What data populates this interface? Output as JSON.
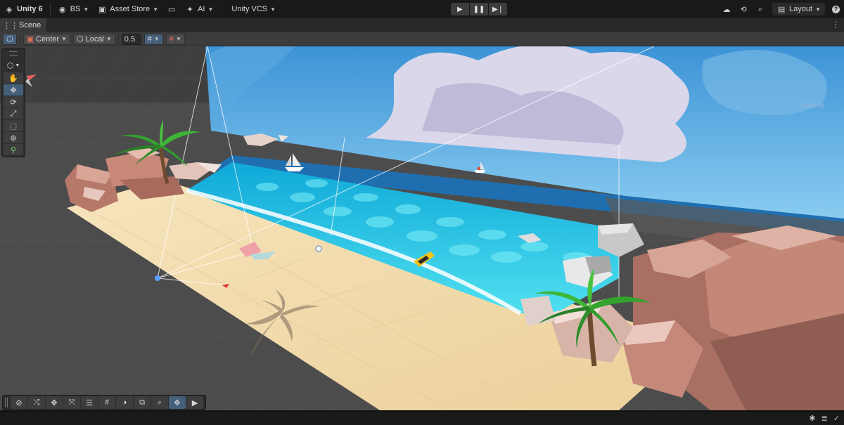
{
  "topbar": {
    "unity_label": "Unity 6",
    "account_label": "BS",
    "asset_store_label": "Asset Store",
    "ai_label": "AI",
    "vcs_label": "Unity VCS",
    "layout_label": "Layout"
  },
  "tabs": [
    {
      "label": "Scene",
      "icon": "grid-icon"
    }
  ],
  "scene_toolbar": {
    "pivot_mode": "Center",
    "pivot_rotation": "Local",
    "snap_increment": "0.5"
  },
  "tools": [
    "view-tool",
    "hand-tool",
    "move-tool",
    "rotate-tool",
    "scale-tool",
    "rect-tool",
    "transform-tool",
    "custom-tool"
  ],
  "gizmo": {
    "view_label": "Persp",
    "axes": [
      "x",
      "y",
      "z"
    ]
  },
  "overlay_tools": [
    "wireframe",
    "shuffle",
    "move",
    "rotate-scale",
    "align",
    "grid-snap",
    "shading",
    "layers",
    "search",
    "pan",
    "camera"
  ],
  "colors": {
    "accent": "#46607c",
    "sky": "#4aa3e0",
    "water": "#28c5e6",
    "sand": "#f1d9a8",
    "rock": "#b37a6e",
    "palm": "#2f9e2c",
    "ground": "#4b4b4b"
  }
}
